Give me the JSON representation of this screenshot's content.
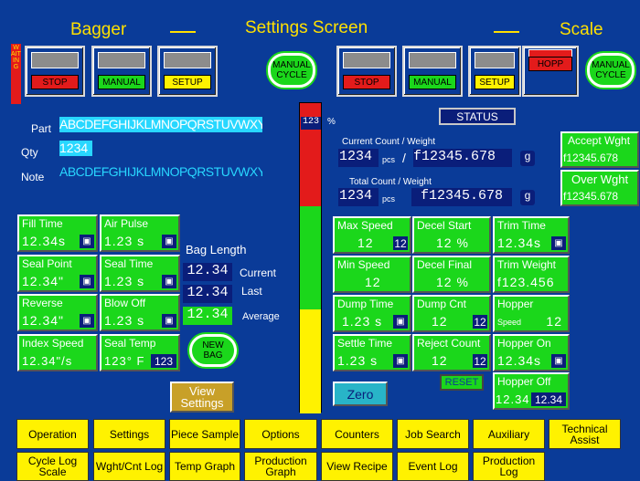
{
  "header": {
    "left": "Bagger",
    "center": "Settings Screen",
    "right": "Scale",
    "waiting": "WAITING"
  },
  "bagger_buttons": [
    "STOP",
    "MANUAL",
    "SETUP"
  ],
  "scale_buttons": [
    "STOP",
    "MANUAL",
    "SETUP",
    "HOPP"
  ],
  "manual_cycle": "MANUAL CYCLE",
  "part": {
    "label": "Part",
    "value": "ABCDEFGHIJKLMNOPQRSTUVWXY"
  },
  "qty": {
    "label": "Qty",
    "value": "1234"
  },
  "note": {
    "label": "Note",
    "value": "ABCDEFGHIJKLMNOPQRSTUVWXY"
  },
  "meter": {
    "value": "123",
    "unit": "%"
  },
  "status": "STATUS",
  "current": {
    "label": "Current Count / Weight",
    "count": "1234",
    "pcs": "pcs",
    "slash": "/",
    "weight": "f12345.678",
    "unit": "g"
  },
  "total": {
    "label": "Total Count / Weight",
    "count": "1234",
    "pcs": "pcs",
    "weight": "f12345.678",
    "unit": "g"
  },
  "accept": {
    "label": "Accept Wght",
    "value": "f12345.678"
  },
  "over": {
    "label": "Over Wght",
    "value": "f12345.678"
  },
  "bagger_tiles": [
    {
      "label": "Fill Time",
      "value": "12.34s"
    },
    {
      "label": "Air Pulse",
      "value": "1.23 s"
    },
    {
      "label": "Seal Point",
      "value": "12.34\""
    },
    {
      "label": "Seal Time",
      "value": "1.23 s"
    },
    {
      "label": "Reverse",
      "value": "12.34\""
    },
    {
      "label": "Blow Off",
      "value": "1.23 s"
    },
    {
      "label": "Index Speed",
      "value": "12.34\"/s"
    },
    {
      "label": "Seal Temp",
      "value": "123° F",
      "extra": "123"
    }
  ],
  "bag_length": {
    "title": "Bag Length",
    "current": "12.34",
    "current_label": "Current",
    "last": "12.34",
    "last_label": "Last",
    "average": "12.34",
    "average_label": "Average"
  },
  "new_bag": "NEW BAG",
  "scale_tiles": [
    {
      "label": "Max Speed",
      "value": "12",
      "extra": "12"
    },
    {
      "label": "Decel Start",
      "value": "12 %"
    },
    {
      "label": "Trim Time",
      "value": "12.34s"
    },
    {
      "label": "Min Speed",
      "value": "12"
    },
    {
      "label": "Decel Final",
      "value": "12 %"
    },
    {
      "label": "Trim Weight",
      "value": "f123.456"
    },
    {
      "label": "Dump Time",
      "value": "1.23 s"
    },
    {
      "label": "Dump Cnt",
      "value": "12",
      "extra": "12"
    },
    {
      "label": "Hopper",
      "sub": "Speed",
      "value": "12"
    },
    {
      "label": "Settle Time",
      "value": "1.23 s"
    },
    {
      "label": "Reject Count",
      "value": "12",
      "extra": "12"
    },
    {
      "label": "Hopper On",
      "value": "12.34s"
    }
  ],
  "hopper_off": {
    "label": "Hopper Off",
    "value": "12.34",
    "extra": "12.34"
  },
  "reset": "RESET",
  "zero": "Zero",
  "view_settings": "View Settings",
  "nav_row1": [
    "Operation",
    "Settings",
    "Piece Sample",
    "Options",
    "Counters",
    "Job Search",
    "Auxiliary",
    "Technical Assist"
  ],
  "nav_row2": [
    "Cycle Log Scale",
    "Wght/Cnt Log",
    "Temp Graph",
    "Production Graph",
    "View Recipe",
    "Event Log",
    "Production Log"
  ]
}
